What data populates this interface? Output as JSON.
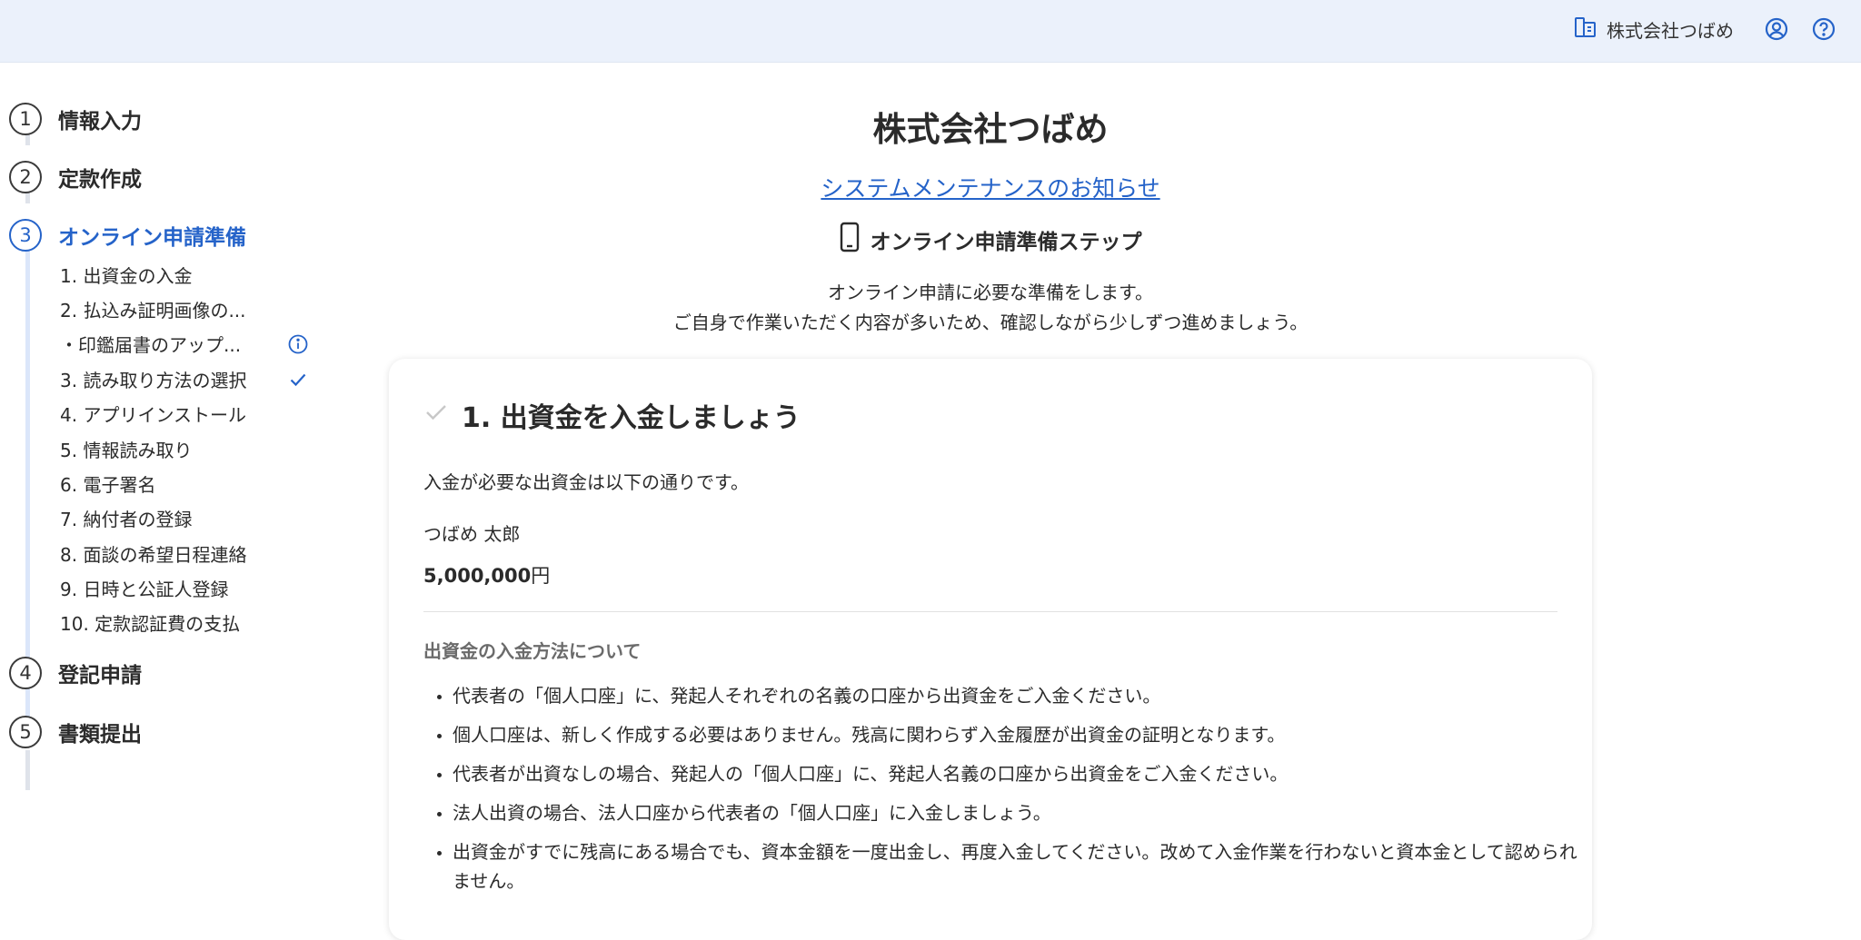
{
  "header": {
    "company_name": "株式会社つばめ",
    "icons": [
      "company-icon",
      "account-icon",
      "help-icon"
    ]
  },
  "sidebar": {
    "steps": [
      {
        "number": "1",
        "label": "情報入力",
        "state": "done"
      },
      {
        "number": "2",
        "label": "定款作成",
        "state": "done"
      },
      {
        "number": "3",
        "label": "オンライン申請準備",
        "state": "active"
      },
      {
        "number": "4",
        "label": "登記申請",
        "state": "todo"
      },
      {
        "number": "5",
        "label": "書類提出",
        "state": "todo"
      }
    ],
    "substeps": [
      {
        "label": "1. 出資金の入金"
      },
      {
        "label": "2. 払込み証明画像の..."
      },
      {
        "label": "・印鑑届書のアップ...",
        "icon": "info-icon"
      },
      {
        "label": "3. 読み取り方法の選択",
        "icon": "check-icon"
      },
      {
        "label": "4. アプリインストール"
      },
      {
        "label": "5. 情報読み取り"
      },
      {
        "label": "6. 電子署名"
      },
      {
        "label": "7. 納付者の登録"
      },
      {
        "label": "8. 面談の希望日程連絡"
      },
      {
        "label": "9. 日時と公証人登録"
      },
      {
        "label": "10. 定款認証費の支払"
      }
    ],
    "colors": {
      "active": "#2563c9",
      "rail": "#dfe3ea"
    }
  },
  "main": {
    "title": "株式会社つばめ",
    "notice_link": "システムメンテナンスのお知らせ",
    "section_icon": "smartphone-icon",
    "section_heading": "オンライン申請準備ステップ",
    "intro_line1": "オンライン申請に必要な準備をします。",
    "intro_line2": "ご自身で作業いただく内容が多いため、確認しながら少しずつ進めましょう。"
  },
  "card": {
    "title_icon": "check-icon",
    "title": "1. 出資金を入金しましょう",
    "lead": "入金が必要な出資金は以下の通りです。",
    "investor_name": "つばめ 太郎",
    "amount_value": "5,000,000",
    "amount_unit": "円",
    "subhead": "出資金の入金方法について",
    "bullets": [
      "代表者の「個人口座」に、発起人それぞれの名義の口座から出資金をご入金ください。",
      "個人口座は、新しく作成する必要はありません。残高に関わらず入金履歴が出資金の証明となります。",
      "代表者が出資なしの場合、発起人の「個人口座」に、発起人名義の口座から出資金をご入金ください。",
      "法人出資の場合、法人口座から代表者の「個人口座」に入金しましょう。",
      "出資金がすでに残高にある場合でも、資本金額を一度出金し、再度入金してください。改めて入金作業を行わないと資本金として認められません。"
    ]
  },
  "colors": {
    "header_bg": "#ebf1fb",
    "link": "#2563c9",
    "text": "#2b2b2b"
  }
}
